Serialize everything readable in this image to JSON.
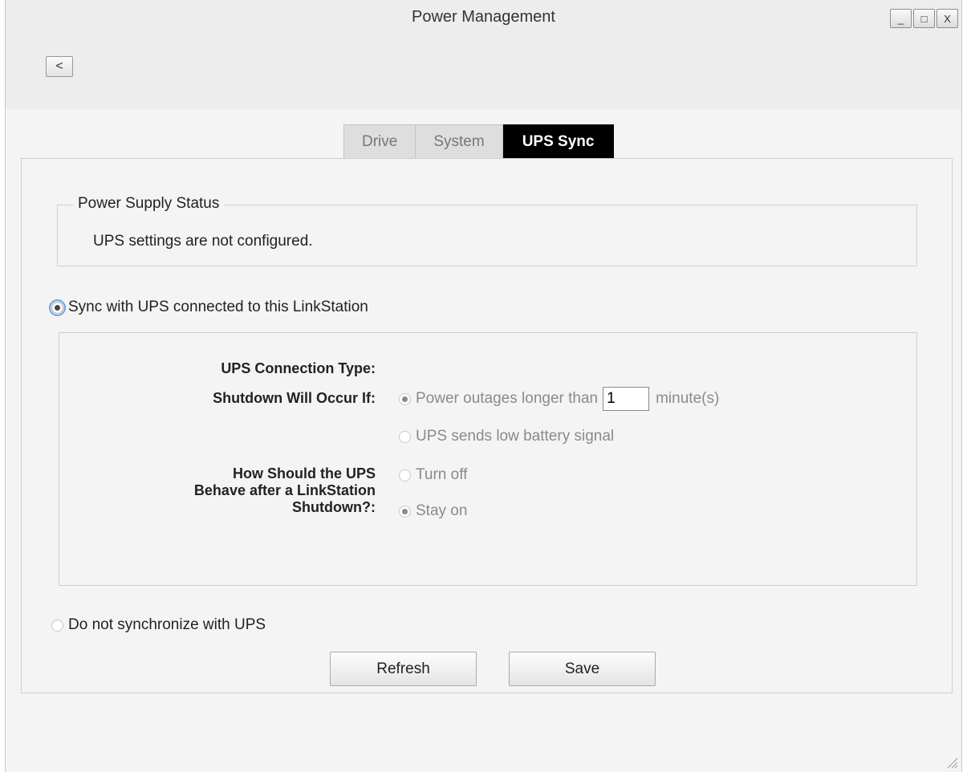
{
  "window": {
    "title": "Power Management",
    "minimize_glyph": "_",
    "maximize_glyph": "□",
    "close_glyph": "X",
    "back_glyph": "<"
  },
  "tabs": [
    {
      "label": "Drive",
      "active": false
    },
    {
      "label": "System",
      "active": false
    },
    {
      "label": "UPS Sync",
      "active": true
    }
  ],
  "power_supply": {
    "legend": "Power Supply Status",
    "status": "UPS settings are not configured."
  },
  "sync_option": {
    "label": "Sync with UPS connected to this LinkStation",
    "checked": true
  },
  "settings": {
    "connection_type_label": "UPS Connection Type:",
    "shutdown_label": "Shutdown Will Occur If:",
    "shutdown_options": [
      {
        "label": "Power outages longer than",
        "checked": true
      },
      {
        "label": "UPS sends low battery signal",
        "checked": false
      }
    ],
    "minutes_value": "1",
    "minutes_unit": "minute(s)",
    "behave_label_line1": "How Should the UPS",
    "behave_label_line2": "Behave after a LinkStation",
    "behave_label_line3": "Shutdown?:",
    "behave_options": [
      {
        "label": "Turn off",
        "checked": false
      },
      {
        "label": "Stay on",
        "checked": true
      }
    ]
  },
  "no_sync_option": {
    "label": "Do not synchronize with UPS",
    "checked": false
  },
  "buttons": {
    "refresh": "Refresh",
    "save": "Save"
  }
}
